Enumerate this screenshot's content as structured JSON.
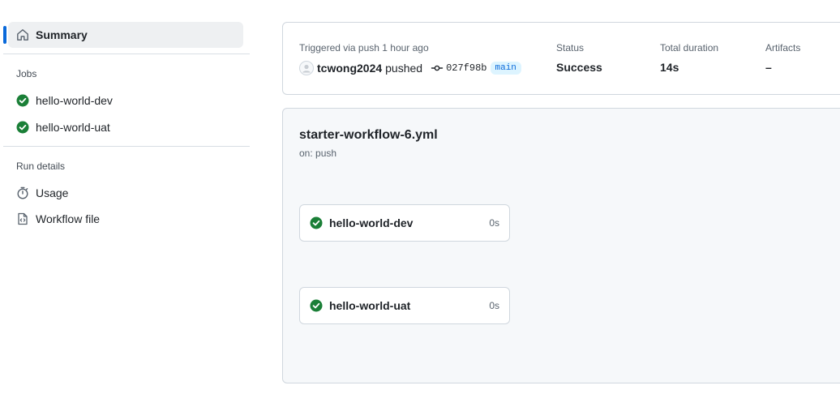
{
  "sidebar": {
    "summary_label": "Summary",
    "jobs_heading": "Jobs",
    "jobs": [
      {
        "label": "hello-world-dev"
      },
      {
        "label": "hello-world-uat"
      }
    ],
    "run_details_heading": "Run details",
    "details": [
      {
        "label": "Usage",
        "icon": "stopwatch-icon"
      },
      {
        "label": "Workflow file",
        "icon": "file-code-icon"
      }
    ]
  },
  "summary": {
    "triggered_text": "Triggered via push 1 hour ago",
    "actor": "tcwong2024",
    "action": "pushed",
    "commit": "027f98b",
    "branch": "main",
    "status_label": "Status",
    "status_value": "Success",
    "duration_label": "Total duration",
    "duration_value": "14s",
    "artifacts_label": "Artifacts",
    "artifacts_value": "–"
  },
  "workflow": {
    "name": "starter-workflow-6.yml",
    "trigger": "on: push",
    "jobs": [
      {
        "name": "hello-world-dev",
        "duration": "0s"
      },
      {
        "name": "hello-world-uat",
        "duration": "0s"
      }
    ]
  },
  "colors": {
    "success": "#1a7f37",
    "accent": "#0969da",
    "branch_bg": "#ddf4ff"
  }
}
